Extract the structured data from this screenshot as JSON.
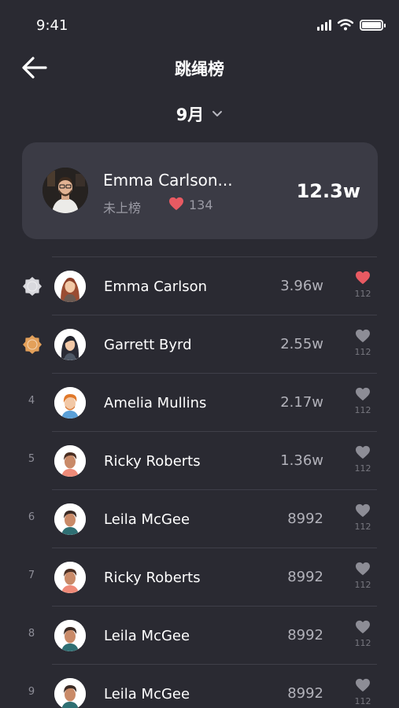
{
  "status_bar": {
    "time": "9:41"
  },
  "header": {
    "title": "跳绳榜",
    "month": "9月"
  },
  "my_card": {
    "name": "Emma Carlson...",
    "status": "未上榜",
    "likes": "134",
    "score": "12.3w"
  },
  "rankings": [
    {
      "rank": "1",
      "name": "Emma Carlson",
      "score": "3.96w",
      "likes": "112",
      "liked": true,
      "avatar": "female-red-hair",
      "medal": "silver"
    },
    {
      "rank": "2",
      "name": "Garrett Byrd",
      "score": "2.55w",
      "likes": "112",
      "liked": false,
      "avatar": "female-dark-hair",
      "medal": "bronze"
    },
    {
      "rank": "4",
      "name": "Amelia Mullins",
      "score": "2.17w",
      "likes": "112",
      "liked": false,
      "avatar": "male-orange-hair"
    },
    {
      "rank": "5",
      "name": "Ricky Roberts",
      "score": "1.36w",
      "likes": "112",
      "liked": false,
      "avatar": "male-brown-coral-shirt"
    },
    {
      "rank": "6",
      "name": "Leila McGee",
      "score": "8992",
      "likes": "112",
      "liked": false,
      "avatar": "male-brown-teal-shirt"
    },
    {
      "rank": "7",
      "name": "Ricky Roberts",
      "score": "8992",
      "likes": "112",
      "liked": false,
      "avatar": "male-brown-coral-shirt"
    },
    {
      "rank": "8",
      "name": "Leila McGee",
      "score": "8992",
      "likes": "112",
      "liked": false,
      "avatar": "male-brown-teal-shirt"
    },
    {
      "rank": "9",
      "name": "Leila McGee",
      "score": "8992",
      "likes": "112",
      "liked": false,
      "avatar": "male-brown-teal-shirt"
    }
  ],
  "colors": {
    "background": "#2a2a32",
    "card": "#3b3b45",
    "heart_active": "#e85a62",
    "heart_inactive": "#8d8d96",
    "medal_silver": "#d9d9de",
    "medal_bronze": "#e3a05a"
  }
}
